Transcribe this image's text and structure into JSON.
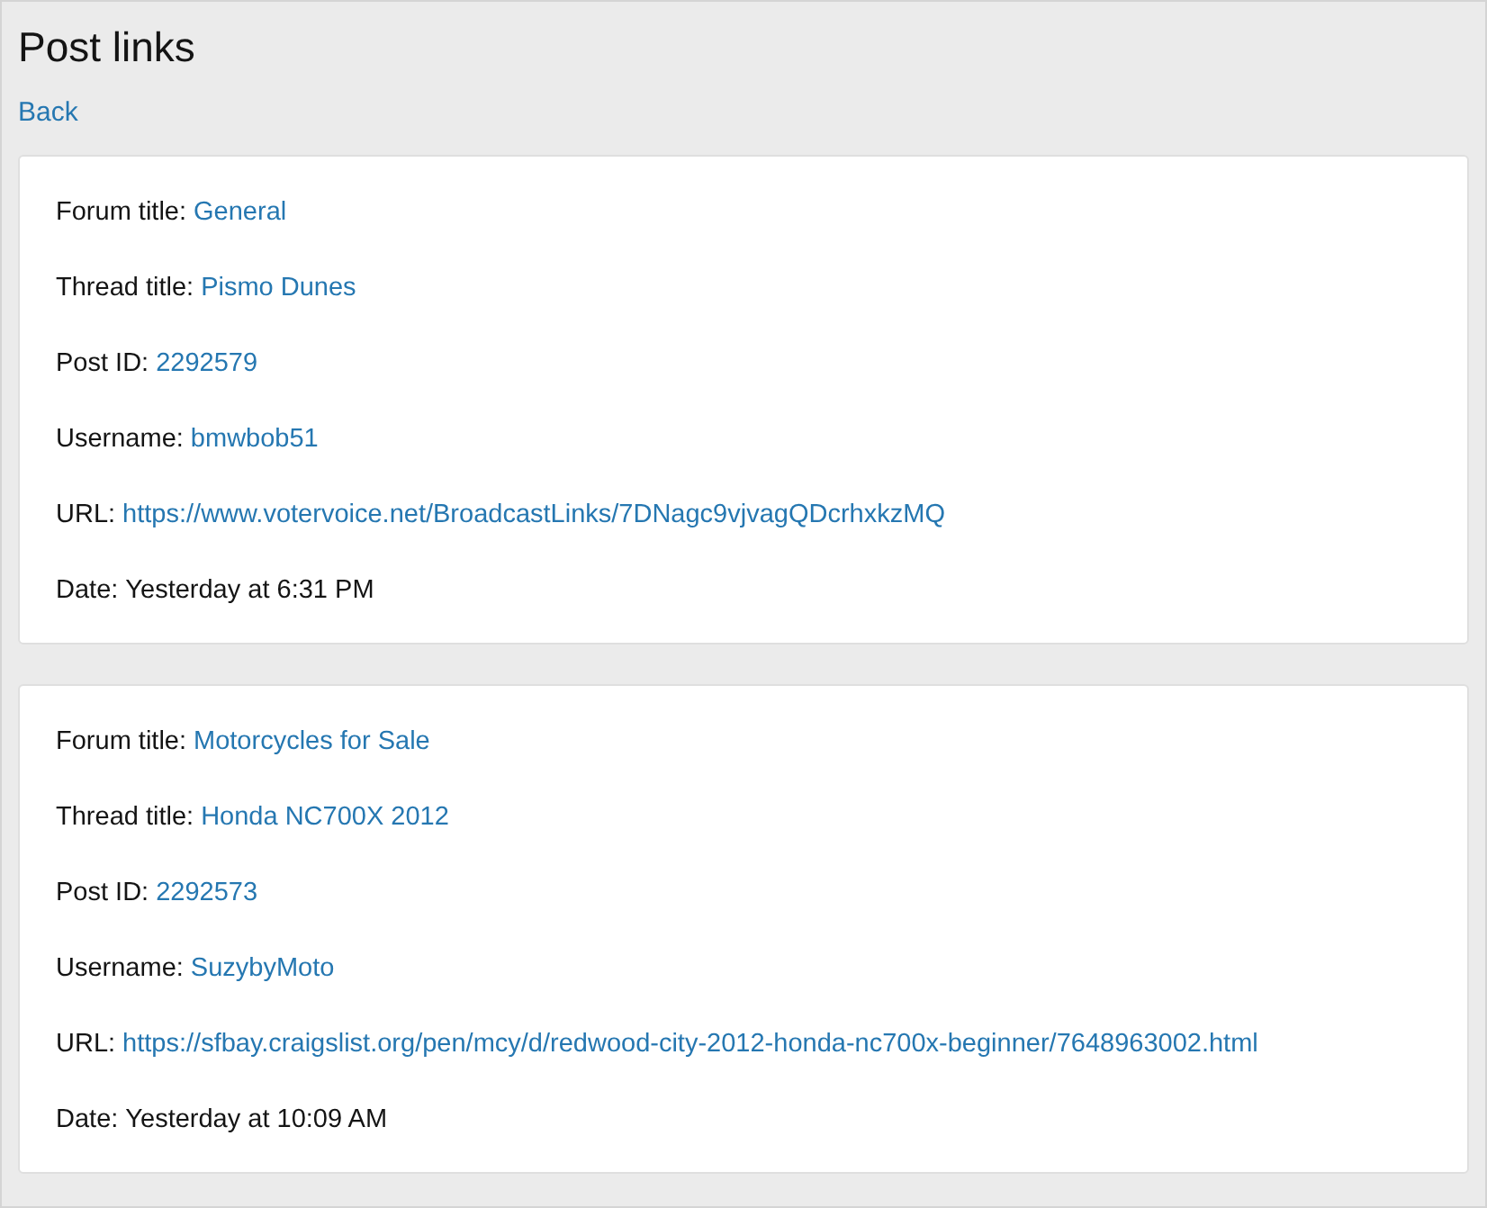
{
  "page": {
    "title": "Post links",
    "back_link": "Back"
  },
  "posts": [
    {
      "fields": [
        {
          "label": "Forum title:",
          "value": "General",
          "kind": "link"
        },
        {
          "label": "Thread title:",
          "value": "Pismo Dunes",
          "kind": "link"
        },
        {
          "label": "Post ID:",
          "value": "2292579",
          "kind": "link"
        },
        {
          "label": "Username:",
          "value": "bmwbob51",
          "kind": "link"
        },
        {
          "label": "URL:",
          "value": "https://www.votervoice.net/BroadcastLinks/7DNagc9vjvagQDcrhxkzMQ",
          "kind": "link"
        },
        {
          "label": "Date:",
          "value": "Yesterday at 6:31 PM",
          "kind": "text"
        }
      ]
    },
    {
      "fields": [
        {
          "label": "Forum title:",
          "value": "Motorcycles for Sale",
          "kind": "link"
        },
        {
          "label": "Thread title:",
          "value": "Honda NC700X 2012",
          "kind": "link"
        },
        {
          "label": "Post ID:",
          "value": "2292573",
          "kind": "link"
        },
        {
          "label": "Username:",
          "value": "SuzybyMoto",
          "kind": "link"
        },
        {
          "label": "URL:",
          "value": "https://sfbay.craigslist.org/pen/mcy/d/redwood-city-2012-honda-nc700x-beginner/7648963002.html",
          "kind": "link"
        },
        {
          "label": "Date:",
          "value": "Yesterday at 10:09 AM",
          "kind": "text"
        }
      ]
    }
  ]
}
